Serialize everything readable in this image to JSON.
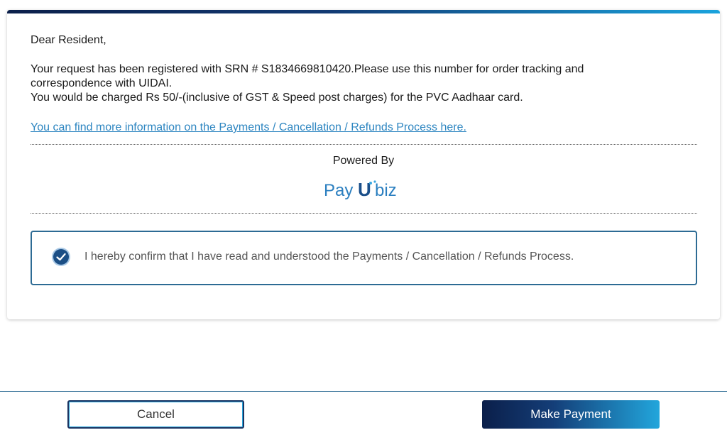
{
  "letter": {
    "greeting": "Dear Resident,",
    "line1": "Your request has been registered with SRN # S1834669810420.Please use this number for order tracking and",
    "line2": "correspondence with UIDAI.",
    "line3": "You would be charged Rs 50/-(inclusive of GST & Speed post charges) for the PVC Aadhaar card.",
    "info_link": "You can find more information on the Payments / Cancellation / Refunds Process here."
  },
  "powered_by": {
    "label": "Powered By",
    "brand_left": "Pay",
    "brand_mark": "U",
    "brand_right": "biz"
  },
  "confirm": {
    "checked": true,
    "text": "I hereby confirm that I have read and understood the Payments / Cancellation / Refunds Process."
  },
  "footer": {
    "cancel_label": "Cancel",
    "pay_label": "Make Payment"
  },
  "colors": {
    "accent_dark": "#0b1f4a",
    "accent_light": "#22a6dc",
    "link": "#2e86c1",
    "brand": "#2b7fc0"
  }
}
